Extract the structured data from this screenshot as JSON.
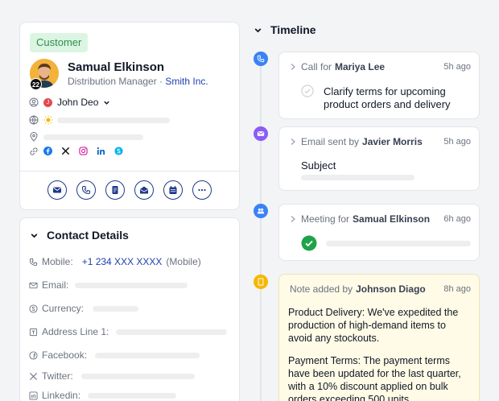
{
  "contact": {
    "status": "Customer",
    "avatar_badge": "22",
    "name": "Samual Elkinson",
    "role": "Distribution Manager",
    "separator": " · ",
    "company": "Smith Inc.",
    "owner": "John Deo",
    "actions": [
      "mail-icon",
      "phone-icon",
      "note-icon",
      "email-icon",
      "calendar-icon",
      "more-icon"
    ]
  },
  "details": {
    "title": "Contact Details",
    "mobile_label": "Mobile:",
    "mobile_value": "+1 234 XXX XXXX",
    "mobile_type": "(Mobile)",
    "email_label": "Email:",
    "currency_label": "Currency:",
    "address_label": "Address Line 1:",
    "facebook_label": "Facebook:",
    "twitter_label": "Twitter:",
    "linkedin_label": "Linkedin:"
  },
  "timeline": {
    "title": "Timeline",
    "items": [
      {
        "type": "call",
        "action": "Call for",
        "person": "Mariya Lee",
        "time": "5h ago",
        "body": "Clarify terms for upcoming product orders and delivery"
      },
      {
        "type": "email",
        "action": "Email sent by",
        "person": "Javier Morris",
        "time": "5h ago",
        "body": "Subject"
      },
      {
        "type": "meeting",
        "action": "Meeting for",
        "person": "Samual Elkinson",
        "time": "6h ago"
      },
      {
        "type": "note",
        "action": "Note added by",
        "person": "Johnson Diago",
        "time": "8h ago",
        "body": "Product Delivery: We've expedited the production of high-demand items to avoid any stockouts.",
        "body2": "Payment Terms: The payment terms have been updated for the last quarter, with a 10% discount applied on bulk orders exceeding 500 units."
      }
    ]
  },
  "colors": {
    "accent": "#1e40af",
    "call": "#3b82f6",
    "email": "#8b5cf6",
    "meeting": "#3b82f6",
    "note": "#f5b700",
    "done": "#1fa34a"
  }
}
